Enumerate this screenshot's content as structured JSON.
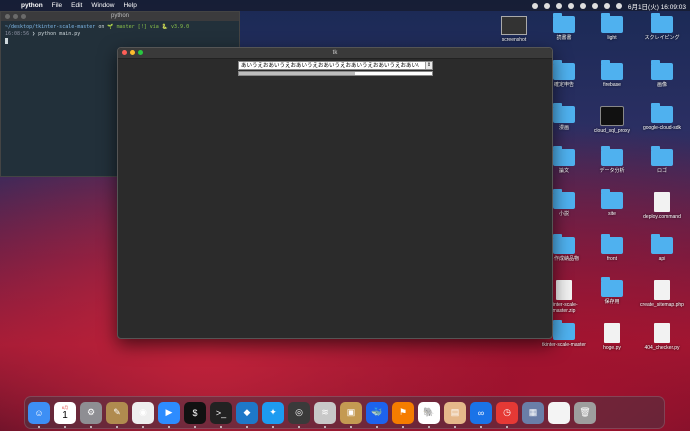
{
  "menubar": {
    "app": "python",
    "menus": [
      "File",
      "Edit",
      "Window",
      "Help"
    ],
    "clock": "6月1日(火) 16:09:03"
  },
  "terminal": {
    "title": "python",
    "line1_path": "~/desktop/tkinter-scale-master",
    "line1_on": "on",
    "line1_branch": "🌱 master [!]",
    "line1_via": "via 🐍 v3.9.0",
    "line2_time": "16:08:56",
    "line2_cmd": "❯ python main.py"
  },
  "tk": {
    "title": "tk",
    "combo_value": "あいうえおあいうえおあいうえおあいうえおあいうえおあいうえおあい\\",
    "progress": 0.6
  },
  "desktop": {
    "icons": [
      {
        "label": "screenshot",
        "type": "shot"
      },
      {
        "label": "読書書",
        "type": "folder"
      },
      {
        "label": "light",
        "type": "folder"
      },
      {
        "label": "スクレイピング",
        "type": "folder"
      },
      {
        "label": "確定申告",
        "type": "folder"
      },
      {
        "label": "firebase",
        "type": "folder"
      },
      {
        "label": "画像",
        "type": "folder"
      },
      {
        "label": "漫画",
        "type": "folder"
      },
      {
        "label": "cloud_sql_proxy",
        "type": "term"
      },
      {
        "label": "google-cloud-sdk",
        "type": "folder"
      },
      {
        "label": "論文",
        "type": "folder"
      },
      {
        "label": "データ分析",
        "type": "folder"
      },
      {
        "label": "ロゴ",
        "type": "folder"
      },
      {
        "label": "小説",
        "type": "folder"
      },
      {
        "label": "site",
        "type": "folder"
      },
      {
        "label": "deploy.command",
        "type": "file"
      },
      {
        "label": "ト作成納品物",
        "type": "folder"
      },
      {
        "label": "front",
        "type": "folder"
      },
      {
        "label": "api",
        "type": "folder"
      },
      {
        "label": "kinter-scale-master.zip",
        "type": "file"
      },
      {
        "label": "保存用",
        "type": "folder"
      },
      {
        "label": "create_sitemap.php",
        "type": "file"
      },
      {
        "label": "tkinter-scale-master",
        "type": "folder"
      },
      {
        "label": "hoge.py",
        "type": "file"
      },
      {
        "label": "404_checker.py",
        "type": "file"
      }
    ]
  },
  "dock": {
    "calendar_month": "6月",
    "calendar_day": "1",
    "apps": [
      {
        "name": "finder",
        "color": "#3d8ff5",
        "glyph": "☺"
      },
      {
        "name": "calendar",
        "color": "#ffffff",
        "glyph": ""
      },
      {
        "name": "system-preferences",
        "color": "#8e8e93",
        "glyph": "⚙"
      },
      {
        "name": "script-editor",
        "color": "#b08b4f",
        "glyph": "✎"
      },
      {
        "name": "chrome",
        "color": "#eeeeee",
        "glyph": "◉"
      },
      {
        "name": "zoom",
        "color": "#2d8cff",
        "glyph": "▶"
      },
      {
        "name": "terminal",
        "color": "#111111",
        "glyph": "$"
      },
      {
        "name": "terminal-2",
        "color": "#222222",
        "glyph": ">_"
      },
      {
        "name": "vscode",
        "color": "#1e78c8",
        "glyph": "◆"
      },
      {
        "name": "safari",
        "color": "#1d9bf0",
        "glyph": "✦"
      },
      {
        "name": "quicktime",
        "color": "#3a3a3a",
        "glyph": "◎"
      },
      {
        "name": "sequel",
        "color": "#c8c8c8",
        "glyph": "≋"
      },
      {
        "name": "archive",
        "color": "#c49a52",
        "glyph": "▣"
      },
      {
        "name": "docker",
        "color": "#1d63ed",
        "glyph": "🐳"
      },
      {
        "name": "sourcetree",
        "color": "#f57c00",
        "glyph": "⚑"
      },
      {
        "name": "postgres",
        "color": "#ffffff",
        "glyph": "🐘"
      },
      {
        "name": "preview",
        "color": "#e5b88a",
        "glyph": "▤"
      },
      {
        "name": "infinity",
        "color": "#1a73e8",
        "glyph": "∞"
      },
      {
        "name": "clock",
        "color": "#e53935",
        "glyph": "◷"
      },
      {
        "name": "photos-preview",
        "color": "#6a7ea8",
        "glyph": "▦"
      },
      {
        "name": "document",
        "color": "#f4f4f4",
        "glyph": ""
      },
      {
        "name": "trash",
        "color": "#9e9e9e",
        "glyph": "🗑"
      }
    ]
  }
}
